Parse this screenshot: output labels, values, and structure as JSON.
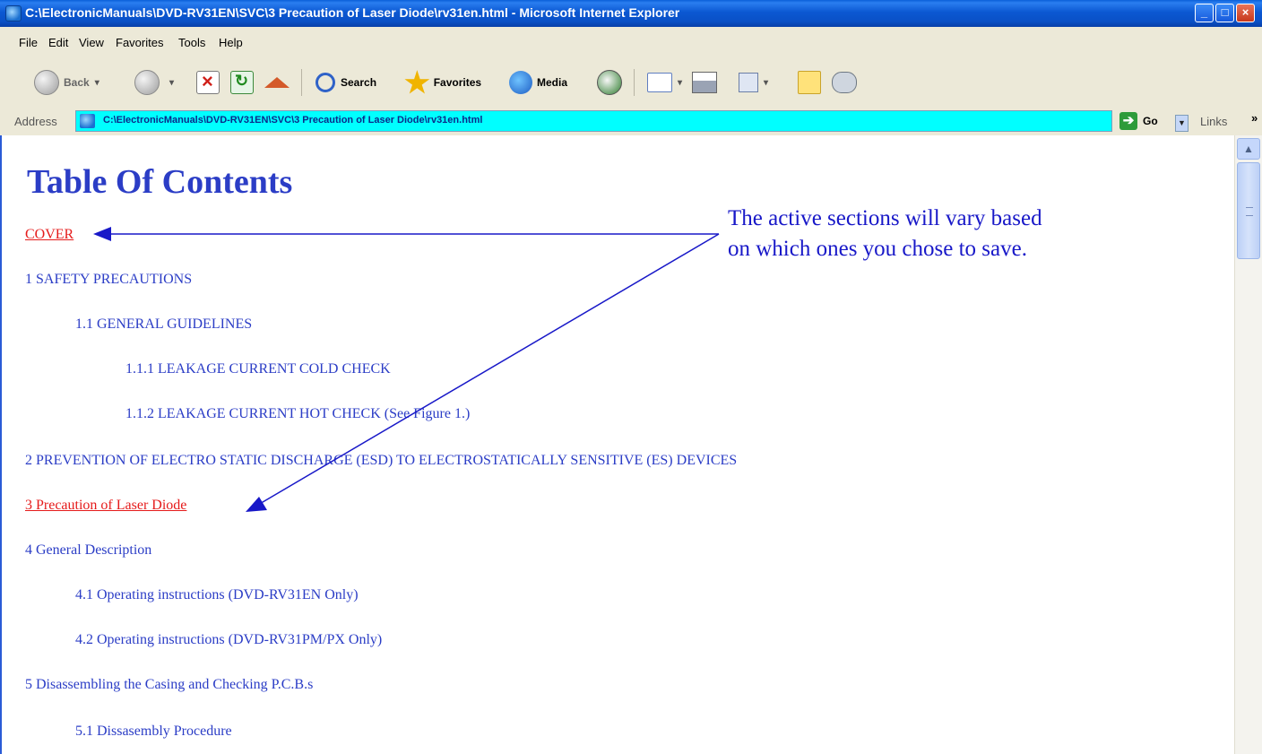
{
  "window": {
    "title": "C:\\ElectronicManuals\\DVD-RV31EN\\SVC\\3 Precaution of Laser Diode\\rv31en.html - Microsoft Internet Explorer",
    "min_label": "_",
    "max_label": "□",
    "close_label": "×"
  },
  "menu": {
    "items": [
      "File",
      "Edit",
      "View",
      "Favorites",
      "Tools",
      "Help"
    ]
  },
  "toolbar": {
    "back_label": "Back",
    "search_label": "Search",
    "favorites_label": "Favorites",
    "media_label": "Media"
  },
  "address": {
    "label": "Address",
    "url": "C:\\ElectronicManuals\\DVD-RV31EN\\SVC\\3 Precaution of Laser Diode\\rv31en.html",
    "go_label": "Go",
    "links_label": "Links"
  },
  "content": {
    "title": "Table Of Contents",
    "items": [
      {
        "text": "COVER",
        "active": true
      },
      {
        "text": "1 SAFETY PRECAUTIONS",
        "active": false
      },
      {
        "text": "1.1 GENERAL GUIDELINES",
        "active": false
      },
      {
        "text": "1.1.1 LEAKAGE CURRENT COLD CHECK",
        "active": false
      },
      {
        "text": "1.1.2 LEAKAGE CURRENT HOT CHECK (See Figure 1.)",
        "active": false
      },
      {
        "text": "2 PREVENTION OF ELECTRO STATIC DISCHARGE (ESD) TO ELECTROSTATICALLY SENSITIVE (ES) DEVICES",
        "active": false
      },
      {
        "text": "3 Precaution of Laser Diode",
        "active": true
      },
      {
        "text": "4 General Description",
        "active": false
      },
      {
        "text": "4.1 Operating instructions (DVD-RV31EN Only)",
        "active": false
      },
      {
        "text": "4.2 Operating instructions (DVD-RV31PM/PX Only)",
        "active": false
      },
      {
        "text": "5 Disassembling the Casing and Checking P.C.B.s",
        "active": false
      },
      {
        "text": "5.1 Dissasembly Procedure",
        "active": false
      }
    ],
    "annotation_line1": "The active sections will vary based",
    "annotation_line2": "on which ones you chose to save."
  },
  "colors": {
    "link": "#2b3dc6",
    "active_link": "#e51b1b",
    "annotation": "#1818c8",
    "address_highlight": "#00ffff"
  }
}
